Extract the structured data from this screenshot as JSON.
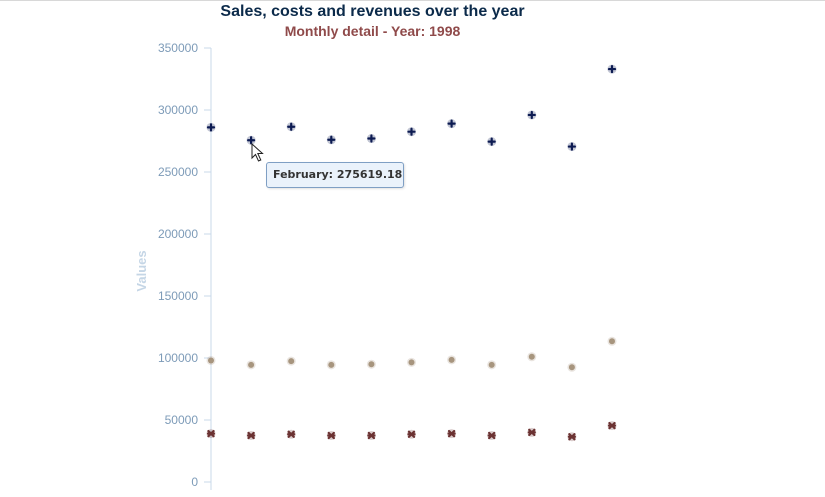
{
  "chart": {
    "title": "Sales, costs and revenues over the year",
    "subtitle": "Monthly detail - Year: 1998"
  },
  "chart_data": {
    "type": "scatter",
    "title": "Sales, costs and revenues over the year",
    "subtitle": "Monthly detail - Year: 1998",
    "ylabel": "Values",
    "ylim": [
      0,
      350000
    ],
    "yticks": [
      "0",
      "50000",
      "100000",
      "150000",
      "200000",
      "250000",
      "300000",
      "350000"
    ],
    "x": [
      1,
      2,
      3,
      4,
      5,
      6,
      7,
      8,
      9,
      10,
      11
    ],
    "series": [
      {
        "color": "#0d1b52",
        "marker": "plus",
        "values": [
          286000,
          275619.18,
          286500,
          276000,
          277000,
          282500,
          289000,
          274500,
          296000,
          270500,
          333000
        ]
      },
      {
        "color": "#a7957e",
        "marker": "circle",
        "values": [
          98000,
          94500,
          97500,
          94500,
          95000,
          96500,
          98500,
          94500,
          101000,
          92500,
          113500
        ]
      },
      {
        "color": "#6b3232",
        "marker": "cross",
        "values": [
          39000,
          37500,
          38500,
          37500,
          37500,
          38500,
          39000,
          37500,
          40000,
          36500,
          45500
        ]
      }
    ],
    "tooltip": {
      "text": "February: 275619.18",
      "series_index": 0,
      "point_index": 1
    },
    "grid": false,
    "legend": "none"
  }
}
